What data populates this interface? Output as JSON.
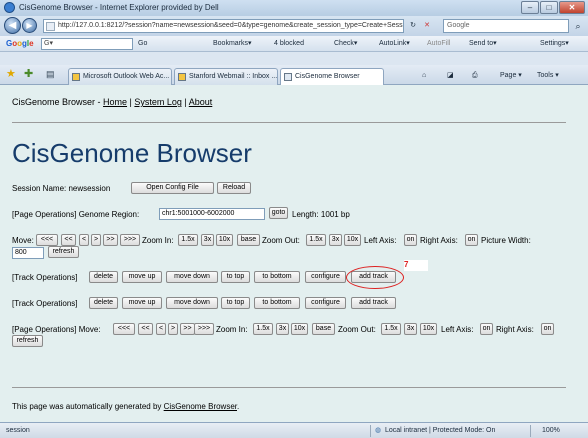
{
  "window": {
    "title": "CisGenome Browser - Internet Explorer provided by Dell",
    "minimize": "–",
    "maximize": "□",
    "close": "✕"
  },
  "addressbar": {
    "back": "◀",
    "forward": "▶",
    "url": "http://127.0.0.1:8212/?session?name=newsession&seed=0&type=genome&create_session_type=Create+Sess",
    "refresh": "↻",
    "stop": "✕",
    "search_placeholder": "Google",
    "search_go": "⌕"
  },
  "googlebar": {
    "logo": [
      "G",
      "o",
      "o",
      "g",
      "l",
      "e"
    ],
    "search_value": "G▾",
    "go_label": "Go",
    "bookmarks": "Bookmarks▾",
    "blocked": "4 blocked",
    "check": "Check▾",
    "autolink": "AutoLink▾",
    "autofill": "AutoFill",
    "sendto": "Send to▾",
    "settings": "Settings▾"
  },
  "tabs": [
    {
      "label": "Microsoft Outlook Web Ac...",
      "active": false
    },
    {
      "label": "Stanford Webmail :: Inbox ...",
      "active": false
    },
    {
      "label": "CisGenome Browser",
      "active": true
    }
  ],
  "toolbar": {
    "page": "Page ▾",
    "tools": "Tools ▾"
  },
  "page": {
    "nav": {
      "prefix": "CisGenome Browser - ",
      "home": "Home",
      "sep1": " | ",
      "system_log": "System Log",
      "sep2": " | ",
      "about": "About"
    },
    "title": "CisGenome Browser",
    "session": {
      "label": "Session Name: newsession",
      "open_config": "Open Config File",
      "reload": "Reload"
    },
    "genome_region": {
      "label": "[Page Operations] Genome Region:",
      "value": "chr1:5001000-6002000",
      "goto": "goto",
      "length": "Length: 1001 bp"
    },
    "move_row": {
      "move": "Move:",
      "buttons": [
        "<<<",
        "<<",
        "<",
        ">",
        ">>",
        ">>>"
      ],
      "zoom_in": "Zoom In:",
      "zoom_in_buttons": [
        "1.5x",
        "3x",
        "10x",
        "base"
      ],
      "zoom_out": "Zoom Out:",
      "zoom_out_buttons": [
        "1.5x",
        "3x",
        "10x"
      ],
      "left_axis": "Left Axis:",
      "left_axis_btn": "on",
      "right_axis": "Right Axis:",
      "right_axis_btn": "on",
      "picture_width": "Picture Width:",
      "width_value": "800",
      "refresh": "refresh"
    },
    "track_ops_1": {
      "label": "[Track Operations]",
      "buttons": [
        "delete",
        "move up",
        "move down",
        "to top",
        "to bottom",
        "configure",
        "add track"
      ]
    },
    "annotation_number": "7",
    "track_ops_2": {
      "label": "[Track Operations]",
      "buttons": [
        "delete",
        "move up",
        "move down",
        "to top",
        "to bottom",
        "configure",
        "add track"
      ]
    },
    "bottom_move": {
      "label": "[Page Operations] Move:",
      "buttons": [
        "<<<",
        "<<",
        "<",
        ">",
        ">>",
        ">>>"
      ],
      "zoom_in": "Zoom In:",
      "zoom_in_buttons": [
        "1.5x",
        "3x",
        "10x",
        "base"
      ],
      "zoom_out": "Zoom Out:",
      "zoom_out_buttons": [
        "1.5x",
        "3x",
        "10x"
      ],
      "left_axis": "Left Axis:",
      "left_axis_btn": "on",
      "right_axis": "Right Axis:",
      "right_axis_btn": "on",
      "refresh": "refresh"
    },
    "footer": {
      "prefix": "This page was automatically generated by ",
      "link": "CisGenome Browser",
      "suffix": "."
    }
  },
  "statusbar": {
    "left": "session",
    "zone": "Local intranet | Protected Mode: On",
    "zoom": "100%"
  },
  "colors": {
    "title_blue": "#163c6b",
    "content_bg": "#e3efef",
    "annotation_red": "#dd2222"
  }
}
